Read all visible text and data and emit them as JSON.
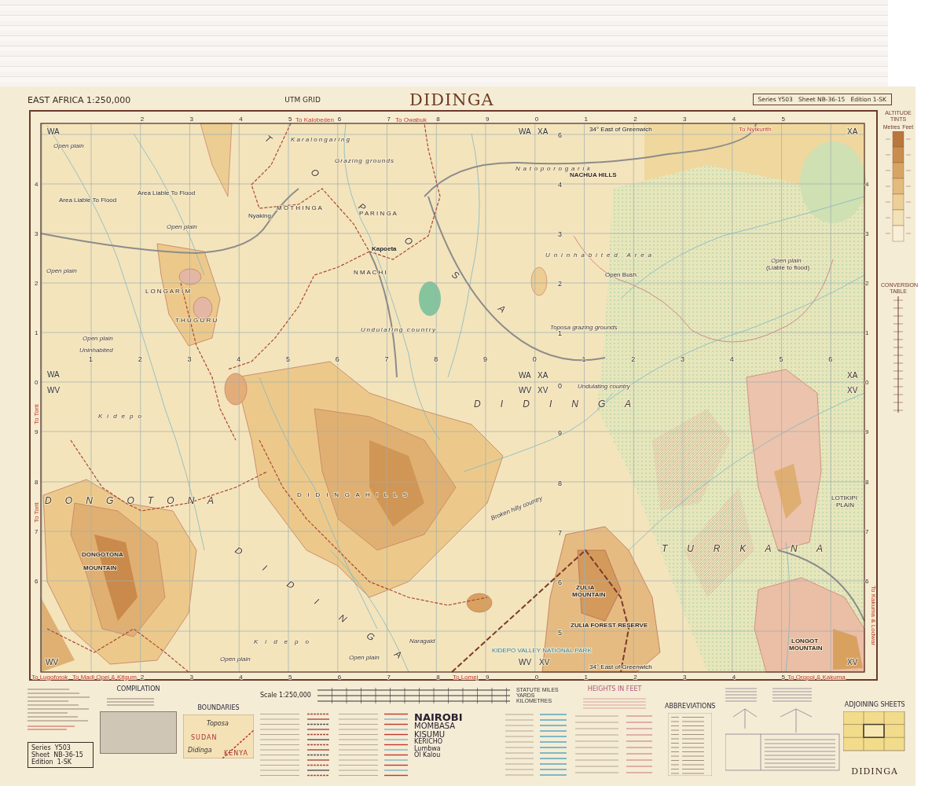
{
  "header": {
    "series_scale": "EAST AFRICA 1:250,000",
    "grid_name": "UTM GRID",
    "title": "DIDINGA",
    "sheet_info": "Series Y503   Sheet NB-36-15   Edition 1-SK"
  },
  "map": {
    "top_numbers": [
      "2",
      "3",
      "4",
      "5",
      "6",
      "7",
      "8",
      "9",
      "0",
      "1",
      "2",
      "3",
      "4",
      "5"
    ],
    "bottom_numbers": [
      "2",
      "3",
      "4",
      "5",
      "6",
      "7",
      "8",
      "9",
      "0",
      "1",
      "2",
      "3",
      "4",
      "5"
    ],
    "left_numbers": [
      "4",
      "3",
      "2",
      "1",
      "0",
      "9",
      "8",
      "7",
      "6"
    ],
    "right_numbers": [
      "4",
      "3",
      "2",
      "1",
      "0",
      "9",
      "8",
      "7",
      "6"
    ],
    "interior_row_numbers": [
      "1",
      "2",
      "3",
      "4",
      "5",
      "6",
      "7",
      "8",
      "9",
      "0",
      "1",
      "2",
      "3",
      "4",
      "5",
      "6"
    ],
    "interior_column_numbers": [
      "6",
      "4",
      "3",
      "2",
      "1",
      "0",
      "9",
      "8",
      "7",
      "6",
      "5"
    ],
    "meridian_notes": [
      "34° East of Greenwich",
      "34° East of Greenwich"
    ],
    "grid_squares": [
      {
        "label": "WA"
      },
      {
        "label": "WA"
      },
      {
        "label": "XA"
      },
      {
        "label": "XA"
      },
      {
        "label": "WA"
      },
      {
        "label": "WA"
      },
      {
        "label": "XA"
      },
      {
        "label": "XA"
      },
      {
        "label": "WV"
      },
      {
        "label": "WV"
      },
      {
        "label": "XV"
      },
      {
        "label": "XV"
      },
      {
        "label": "WV"
      },
      {
        "label": "WV"
      },
      {
        "label": "XV"
      },
      {
        "label": "XV"
      }
    ],
    "route_notes": [
      {
        "text": "To Kalobeden"
      },
      {
        "text": "To Owabuk"
      },
      {
        "text": "To Nyikurith"
      },
      {
        "text": "To Torit"
      },
      {
        "text": "To Torit"
      },
      {
        "text": "To Lugoforok"
      },
      {
        "text": "To Madi Opei & Kitgum"
      },
      {
        "text": "To Lomej"
      },
      {
        "text": "To Oropoi & Kakuma"
      },
      {
        "text": "To Kakuma & Lodwar"
      }
    ],
    "labels": [
      {
        "text": "T O P O S A",
        "kind": "region"
      },
      {
        "text": "D I D I N G A",
        "kind": "region"
      },
      {
        "text": "T U R K A N A",
        "kind": "region"
      },
      {
        "text": "D O N G O T O N A",
        "kind": "region"
      },
      {
        "text": "D I D I N G A",
        "kind": "region"
      },
      {
        "text": "D I D I N G A   H I L L S",
        "kind": "district"
      },
      {
        "text": "L O N G A R I M",
        "kind": "district"
      },
      {
        "text": "T H U G U R U",
        "kind": "district"
      },
      {
        "text": "M O T H I N G A",
        "kind": "district"
      },
      {
        "text": "P A R I N G A",
        "kind": "district"
      },
      {
        "text": "N M A C H I",
        "kind": "district"
      },
      {
        "text": "Uninhabited Area",
        "kind": "feature"
      },
      {
        "text": "Open plain",
        "kind": "feature"
      },
      {
        "text": "Open plain",
        "kind": "feature"
      },
      {
        "text": "Open plain",
        "kind": "feature"
      },
      {
        "text": "Open plain",
        "kind": "feature"
      },
      {
        "text": "Uninhabited",
        "kind": "feature"
      },
      {
        "text": "Grazing grounds",
        "kind": "feature"
      },
      {
        "text": "Karalongaring",
        "kind": "feature"
      },
      {
        "text": "Undulating country",
        "kind": "feature"
      },
      {
        "text": "Toposa grazing grounds",
        "kind": "feature"
      },
      {
        "text": "Natoporogarik",
        "kind": "feature"
      },
      {
        "text": "NACHUA HILLS",
        "kind": "mountain"
      },
      {
        "text": "Broken hilly country",
        "kind": "feature"
      },
      {
        "text": "Kidepo",
        "kind": "feature"
      },
      {
        "text": "Kidepo",
        "kind": "feature"
      },
      {
        "text": "Open plain",
        "kind": "feature"
      },
      {
        "text": "Open plain",
        "kind": "feature"
      },
      {
        "text": "Naragaid",
        "kind": "feature"
      },
      {
        "text": "Open plain",
        "kind": "feature"
      },
      {
        "text": "(Liable to flood)",
        "kind": "place"
      },
      {
        "text": "DONGOTONA",
        "kind": "mountain"
      },
      {
        "text": "MOUNTAIN",
        "kind": "mountain"
      },
      {
        "text": "ZULIA",
        "kind": "mountain"
      },
      {
        "text": "MOUNTAIN",
        "kind": "mountain"
      },
      {
        "text": "ZULIA FOREST RESERVE",
        "kind": "mountain"
      },
      {
        "text": "KIDEPO VALLEY NATIONAL PARK",
        "kind": "park"
      },
      {
        "text": "LONGOT",
        "kind": "mountain"
      },
      {
        "text": "MOUNTAIN",
        "kind": "mountain"
      },
      {
        "text": "LOTIKIPI",
        "kind": "place"
      },
      {
        "text": "PLAIN",
        "kind": "place"
      },
      {
        "text": "Kapoeta",
        "kind": "town"
      },
      {
        "text": "Nyaking",
        "kind": "place"
      },
      {
        "text": "Area Liable To Flood",
        "kind": "place"
      },
      {
        "text": "Area Liable To Flood",
        "kind": "place"
      },
      {
        "text": "Open Bush",
        "kind": "place"
      },
      {
        "text": "Undulating country",
        "kind": "feature"
      }
    ]
  },
  "altitude_tints": {
    "title": "ALTITUDE TINTS",
    "units": [
      "Metres",
      "Feet"
    ],
    "conversion_title": "CONVERSION TABLE"
  },
  "legend": {
    "sheet_box": [
      "Series  Y503",
      "Sheet  NB-36-15",
      "Edition  1-SK"
    ],
    "compilation_title": "COMPILATION",
    "boundaries_title": "BOUNDARIES",
    "boundaries_map_labels": [
      {
        "text": "Toposa"
      },
      {
        "text": "SUDAN"
      },
      {
        "text": "Didinga"
      },
      {
        "text": "KENYA"
      }
    ],
    "scale_title": "Scale 1:250,000",
    "scale_units": [
      "STATUTE MILES",
      "YARDS",
      "KILOMETRES"
    ],
    "towns": [
      {
        "text": "NAIROBI",
        "kind": "city"
      },
      {
        "text": "MOMBASA",
        "kind": "large"
      },
      {
        "text": "KISUMU",
        "kind": "large"
      },
      {
        "text": "KERICHO",
        "kind": "medium"
      },
      {
        "text": "Lumbwa",
        "kind": "small"
      },
      {
        "text": "Ol Kalou",
        "kind": "small"
      }
    ],
    "heights_title": "HEIGHTS IN FEET",
    "abbreviations_title": "ABBREVIATIONS",
    "adjoining_title": "ADJOINING SHEETS",
    "footer_title": "DIDINGA"
  }
}
